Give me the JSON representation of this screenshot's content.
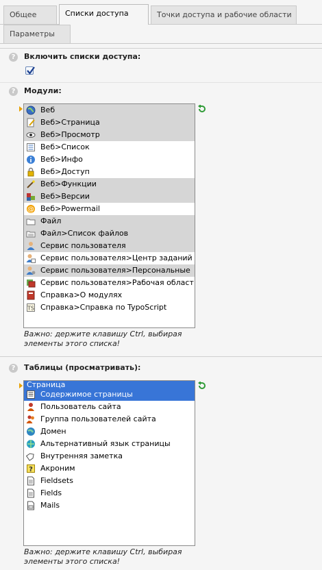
{
  "tabs": [
    {
      "label": "Общее",
      "active": false
    },
    {
      "label": "Списки доступа",
      "active": true
    },
    {
      "label": "Точки доступа и рабочие области",
      "active": false
    },
    {
      "label": "Параметры",
      "active": false
    }
  ],
  "enable_section": {
    "help": "?",
    "title": "Включить списки доступа:",
    "checked": true
  },
  "modules_section": {
    "help": "?",
    "title": "Модули:",
    "items": [
      {
        "label": "Веб",
        "icon": "globe-icon",
        "selected": true
      },
      {
        "label": "Веб>Страница",
        "icon": "page-edit-icon",
        "selected": true
      },
      {
        "label": "Веб>Просмотр",
        "icon": "eye-icon",
        "selected": true
      },
      {
        "label": "Веб>Список",
        "icon": "list-icon",
        "selected": false
      },
      {
        "label": "Веб>Инфо",
        "icon": "info-icon",
        "selected": false
      },
      {
        "label": "Веб>Доступ",
        "icon": "lock-icon",
        "selected": false
      },
      {
        "label": "Веб>Функции",
        "icon": "wand-icon",
        "selected": true
      },
      {
        "label": "Веб>Версии",
        "icon": "versions-icon",
        "selected": true
      },
      {
        "label": "Веб>Powermail",
        "icon": "at-sign-icon",
        "selected": false
      },
      {
        "label": "Файл",
        "icon": "folder-icon",
        "selected": true
      },
      {
        "label": "Файл>Список файлов",
        "icon": "folder-list-icon",
        "selected": true
      },
      {
        "label": "Сервис пользователя",
        "icon": "user-icon",
        "selected": true
      },
      {
        "label": "Сервис пользователя>Центр заданий",
        "icon": "user-tasks-icon",
        "selected": false
      },
      {
        "label": "Сервис пользователя>Персональные",
        "icon": "user-settings-icon",
        "selected": true
      },
      {
        "label": "Сервис пользователя>Рабочая област",
        "icon": "workspace-icon",
        "selected": false
      },
      {
        "label": "Справка>О модулях",
        "icon": "book-icon",
        "selected": false
      },
      {
        "label": "Справка>Справка по TypoScript",
        "icon": "typoscript-icon",
        "selected": false
      }
    ],
    "note": "Важно: держите клавишу Ctrl, выбирая элементы этого списка!"
  },
  "tables_section": {
    "help": "?",
    "title": "Таблицы (просматривать):",
    "items": [
      {
        "label": "Страница",
        "icon": "",
        "selected": true,
        "focused": true
      },
      {
        "label": "Содержимое страницы",
        "icon": "content-icon",
        "selected": true,
        "focused": true
      },
      {
        "label": "Пользователь сайта",
        "icon": "frontend-user-icon",
        "selected": false
      },
      {
        "label": "Группа пользователей сайта",
        "icon": "frontend-group-icon",
        "selected": false
      },
      {
        "label": "Домен",
        "icon": "domain-icon",
        "selected": false
      },
      {
        "label": "Альтернативный язык страницы",
        "icon": "language-icon",
        "selected": false
      },
      {
        "label": "Внутренняя заметка",
        "icon": "tag-icon",
        "selected": false
      },
      {
        "label": "Акроним",
        "icon": "acronym-icon",
        "selected": false
      },
      {
        "label": "Fieldsets",
        "icon": "document-icon",
        "selected": false
      },
      {
        "label": "Fields",
        "icon": "document-icon",
        "selected": false
      },
      {
        "label": "Mails",
        "icon": "mail-doc-icon",
        "selected": false
      }
    ],
    "note": "Важно: держите клавишу Ctrl, выбирая элементы этого списка!"
  },
  "colors": {
    "selected_row": "#d6d6d6",
    "focused_row": "#3875d7",
    "marker": "#e8a100",
    "undo": "#2e9a35"
  }
}
